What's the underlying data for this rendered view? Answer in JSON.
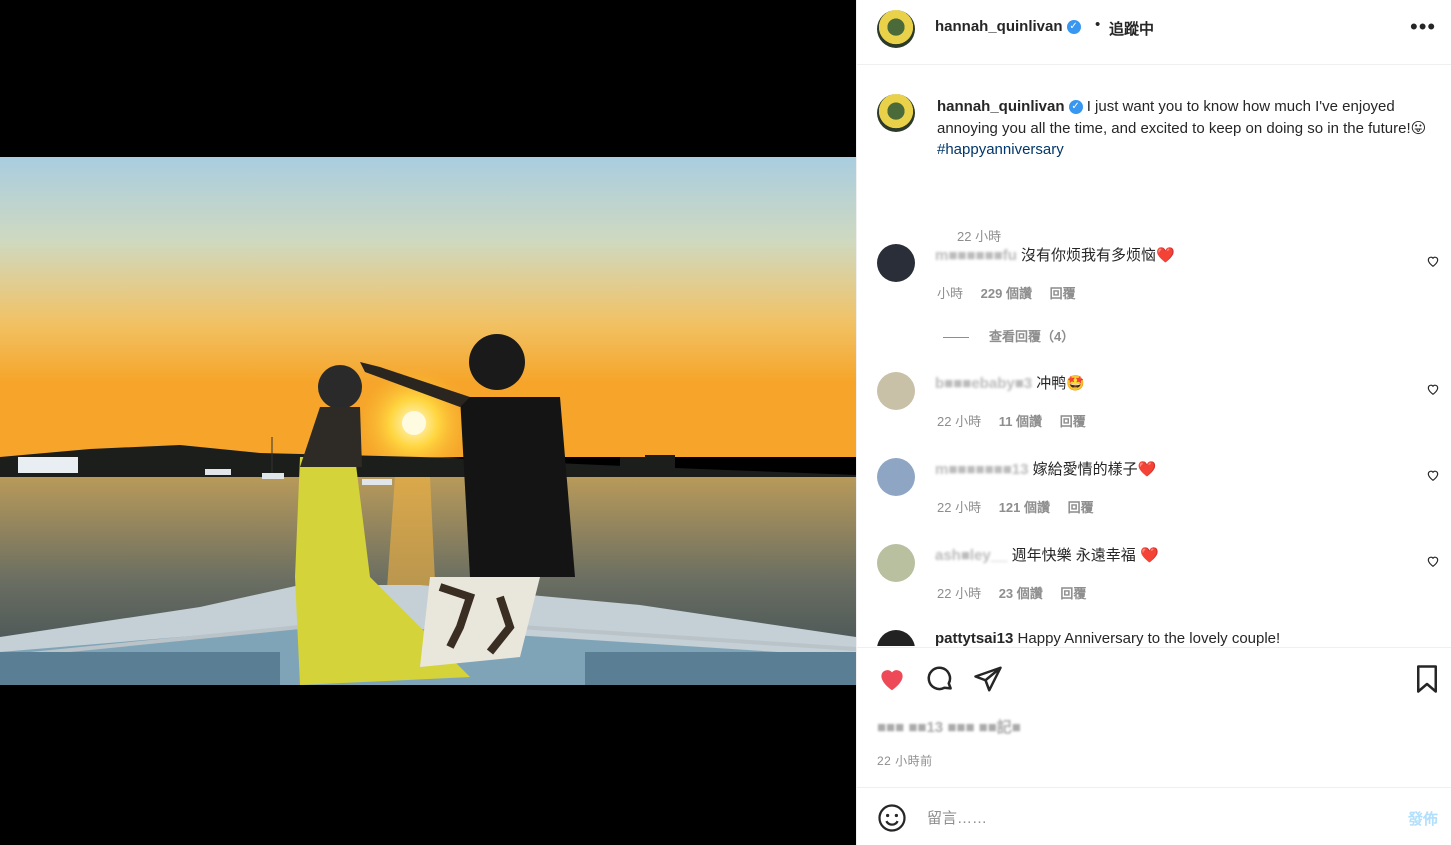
{
  "header": {
    "username": "hannah_quinlivan",
    "separator": "•",
    "follow_status": "追蹤中",
    "more_label": "•••"
  },
  "caption": {
    "username": "hannah_quinlivan",
    "text": "I just want you to know how much I've enjoyed annoying you all the time, and excited to keep on doing so in the future!😛",
    "hashtag": "#happyanniversary",
    "time": "22 小時"
  },
  "comments": [
    {
      "user": "m■■■■■■fu",
      "text": "沒有你烦我有多烦恼❤️",
      "time": "小時",
      "likes": "229 個讚",
      "reply": "回覆"
    },
    {
      "user": "b■■■ebaby■3",
      "text": "冲鸭🤩",
      "time": "22 小時",
      "likes": "11 個讚",
      "reply": "回覆"
    },
    {
      "user": "m■■■■■■■13",
      "text": "嫁給愛情的樣子❤️",
      "time": "22 小時",
      "likes": "121 個讚",
      "reply": "回覆"
    },
    {
      "user": "ash■ley__",
      "text": "週年快樂 永遠幸福 ❤️",
      "time": "22 小時",
      "likes": "23 個讚",
      "reply": "回覆"
    },
    {
      "user": "pattytsai13",
      "text": "Happy Anniversary to the lovely couple!",
      "time": "",
      "likes": "",
      "reply": ""
    }
  ],
  "view_replies": "查看回覆（4）",
  "actions": {
    "likes_line": "■■■ ■■13 ■■■ ■■記■",
    "time_ago": "22 小時前"
  },
  "add_comment": {
    "placeholder": "留言……",
    "post_label": "發佈"
  },
  "colors": {
    "like_red": "#ed4956",
    "link_blue": "#00376b",
    "verified_blue": "#3897f0",
    "post_disabled": "#b2dffc"
  }
}
